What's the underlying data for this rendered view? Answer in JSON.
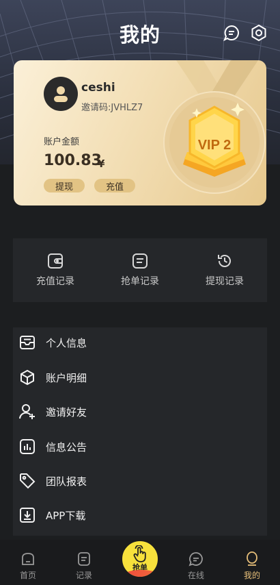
{
  "header": {
    "title": "我的",
    "message_icon": "chat-bubble-icon",
    "settings_icon": "gear-hexagon-icon"
  },
  "profile": {
    "username": "ceshi",
    "invite_code": "邀请码:JVHLZ7",
    "balance_label": "账户金额",
    "balance_value": "100.83",
    "balance_unit": "¥",
    "withdraw_label": "提现",
    "recharge_label": "充值",
    "vip_level": "VIP 2"
  },
  "quick_actions": [
    {
      "label": "充值记录",
      "icon": "wallet-icon"
    },
    {
      "label": "抢单记录",
      "icon": "document-icon"
    },
    {
      "label": "提现记录",
      "icon": "history-icon"
    }
  ],
  "menu": [
    {
      "label": "个人信息",
      "icon": "inbox-icon"
    },
    {
      "label": "账户明细",
      "icon": "cube-icon"
    },
    {
      "label": "邀请好友",
      "icon": "user-add-icon"
    },
    {
      "label": "信息公告",
      "icon": "bar-chart-icon"
    },
    {
      "label": "团队报表",
      "icon": "tag-icon"
    },
    {
      "label": "APP下载",
      "icon": "download-icon"
    }
  ],
  "tabbar": {
    "tabs": [
      {
        "label": "首页",
        "icon": "home-icon"
      },
      {
        "label": "记录",
        "icon": "list-icon"
      },
      {
        "label": "抢单",
        "icon": "tap-hand-icon"
      },
      {
        "label": "在线",
        "icon": "chat-icon"
      },
      {
        "label": "我的",
        "icon": "person-icon"
      }
    ],
    "active": "我的"
  },
  "colors": {
    "accent_gold": "#e8c07a",
    "card_gold": "#f3dfb6",
    "grab_yellow": "#f7e13c",
    "dark_bg": "#1c1e20"
  }
}
